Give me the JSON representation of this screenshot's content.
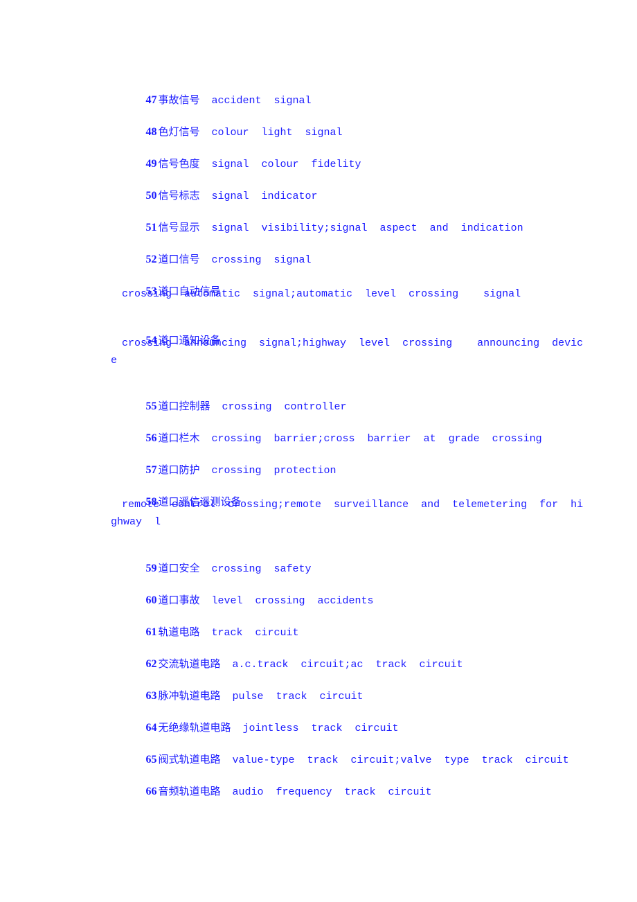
{
  "entries": [
    {
      "num": "47",
      "zh": "事故信号",
      "en": "accident  signal"
    },
    {
      "num": "48",
      "zh": "色灯信号",
      "en": "colour  light  signal"
    },
    {
      "num": "49",
      "zh": "信号色度",
      "en": "signal  colour  fidelity"
    },
    {
      "num": "50",
      "zh": "信号标志",
      "en": "signal  indicator"
    },
    {
      "num": "51",
      "zh": "信号显示",
      "en": "signal  visibility;signal  aspect  and  indication"
    },
    {
      "num": "52",
      "zh": "道口信号",
      "en": "crossing  signal"
    },
    {
      "num": "53",
      "zh": "道口自动信号",
      "en": "",
      "en_line1": "crossing  automatic  signal;automatic  level  crossing    signal"
    },
    {
      "num": "54",
      "zh": "道口通知设备",
      "en": "",
      "en_line1": "crossing  announcing  signal;highway  level  crossing    announcing  devic",
      "en_line2": "e"
    },
    {
      "num": "55",
      "zh": "道口控制器",
      "en": "crossing  controller"
    },
    {
      "num": "56",
      "zh": "道口栏木",
      "en": "crossing  barrier;cross  barrier  at  grade  crossing"
    },
    {
      "num": "57",
      "zh": "道口防护",
      "en": "crossing  protection"
    },
    {
      "num": "58",
      "zh": "道口遥信遥测设备",
      "en": "",
      "en_line1": "remote  control  crossing;remote  surveillance  and  telemetering  for  hi",
      "en_line2": "ghway  l"
    },
    {
      "num": "59",
      "zh": "道口安全",
      "en": "crossing  safety"
    },
    {
      "num": "60",
      "zh": "道口事故",
      "en": "level  crossing  accidents"
    },
    {
      "num": "61",
      "zh": "轨道电路",
      "en": "track  circuit"
    },
    {
      "num": "62",
      "zh": "交流轨道电路",
      "en": "a.c.track  circuit;ac  track  circuit"
    },
    {
      "num": "63",
      "zh": "脉冲轨道电路",
      "en": "pulse  track  circuit"
    },
    {
      "num": "64",
      "zh": "无绝缘轨道电路",
      "en": "jointless  track  circuit"
    },
    {
      "num": "65",
      "zh": "阀式轨道电路",
      "en": "value-type  track  circuit;valve  type  track  circuit"
    },
    {
      "num": "66",
      "zh": "音频轨道电路",
      "en": "audio  frequency  track  circuit"
    }
  ]
}
